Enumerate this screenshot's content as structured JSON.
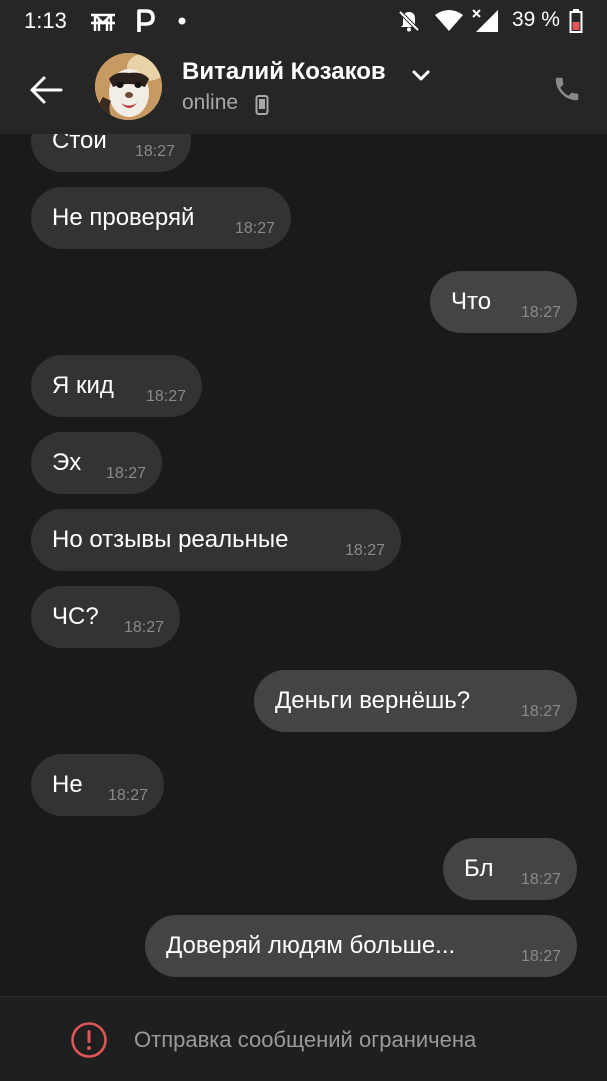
{
  "status_bar": {
    "time": "1:13",
    "battery": "39 %",
    "left_icons": [
      "bridge-icon",
      "parking-icon",
      "dot-icon"
    ],
    "right_icons": [
      "mute-notifications-icon",
      "wifi-icon",
      "signal-icon",
      "battery-icon"
    ]
  },
  "header": {
    "contact_name": "Виталий Козаков",
    "status": "online",
    "icons": [
      "back-arrow-icon",
      "chevron-down-icon",
      "mobile-device-icon",
      "phone-icon"
    ]
  },
  "messages": [
    {
      "direction": "in",
      "text": "Стой",
      "time": "18:27"
    },
    {
      "direction": "in",
      "text": "Не проверяй",
      "time": "18:27"
    },
    {
      "direction": "out",
      "text": "Что",
      "time": "18:27"
    },
    {
      "direction": "in",
      "text": "Я кид",
      "time": "18:27"
    },
    {
      "direction": "in",
      "text": "Эх",
      "time": "18:27"
    },
    {
      "direction": "in",
      "text": "Но отзывы реальные",
      "time": "18:27"
    },
    {
      "direction": "in",
      "text": "ЧС?",
      "time": "18:27"
    },
    {
      "direction": "out",
      "text": "Деньги вернёшь?",
      "time": "18:27"
    },
    {
      "direction": "in",
      "text": "Не",
      "time": "18:27"
    },
    {
      "direction": "out",
      "text": "Бл",
      "time": "18:27"
    },
    {
      "direction": "out",
      "text": "Доверяй людям больше...",
      "time": "18:27"
    }
  ],
  "footer": {
    "notice": "Отправка сообщений ограничена",
    "icon": "warning-icon"
  },
  "colors": {
    "background": "#1a1a1a",
    "header": "#262626",
    "incoming_bubble": "#333333",
    "outgoing_bubble": "#444444",
    "warning": "#e05555"
  }
}
